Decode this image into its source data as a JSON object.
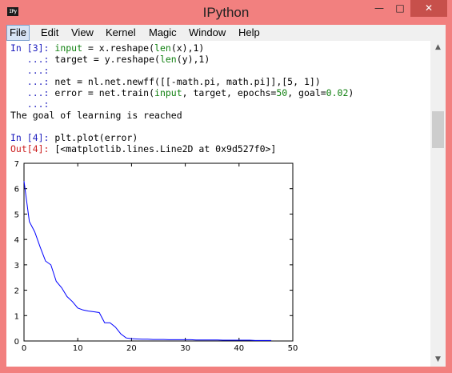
{
  "window": {
    "title": "IPython",
    "app_icon_text": "IPy",
    "controls": {
      "minimize": "—",
      "maximize": "□",
      "close": "✕"
    }
  },
  "menu": {
    "items": [
      "File",
      "Edit",
      "View",
      "Kernel",
      "Magic",
      "Window",
      "Help"
    ],
    "active": "File"
  },
  "console": {
    "cell3": {
      "in_prompt": "In [3]: ",
      "cont_prompt": "   ...: ",
      "l1_pre": "input",
      "l1_mid": " = x.reshape(",
      "l1_fn": "len",
      "l1_post": "(x),1)",
      "l2_pre": "target = y.reshape(",
      "l2_fn": "len",
      "l2_post": "(y),1)",
      "l4_pre": "net = nl.net.newff([[-math.pi, math.pi]],[5, 1])",
      "l5_pre": "error = net.train(",
      "l5_kw": "input",
      "l5_mid": ", target, epochs=",
      "l5_n1": "50",
      "l5_mid2": ", goal=",
      "l5_n2": "0.02",
      "l5_post": ")",
      "output": "The goal of learning is reached"
    },
    "cell4": {
      "in_prompt": "In [4]: ",
      "code": "plt.plot(error)",
      "out_prompt": "Out[4]: ",
      "output": "[<matplotlib.lines.Line2D at 0x9d527f0>]"
    }
  },
  "scrollbar": {
    "up": "▲",
    "down": "▼"
  },
  "chart_data": {
    "type": "line",
    "title": "",
    "xlabel": "",
    "ylabel": "",
    "xlim": [
      0,
      50
    ],
    "ylim": [
      0,
      7
    ],
    "xticks": [
      0,
      10,
      20,
      30,
      40,
      50
    ],
    "yticks": [
      0,
      1,
      2,
      3,
      4,
      5,
      6,
      7
    ],
    "grid": false,
    "line_color": "#0000ff",
    "series": [
      {
        "x": [
          0,
          1,
          2,
          3,
          4,
          5,
          6,
          7,
          8,
          9,
          10,
          11,
          12,
          13,
          14,
          15,
          16,
          17,
          18,
          19,
          20,
          21,
          22,
          23,
          24,
          25,
          26,
          27,
          28,
          29,
          30,
          31,
          32,
          33,
          34,
          35,
          36,
          37,
          38,
          39,
          40,
          41,
          42,
          43,
          44,
          45,
          46
        ],
        "y": [
          6.3,
          4.7,
          4.3,
          3.7,
          3.15,
          3.0,
          2.35,
          2.1,
          1.75,
          1.55,
          1.3,
          1.22,
          1.18,
          1.15,
          1.12,
          0.72,
          0.72,
          0.55,
          0.28,
          0.12,
          0.09,
          0.08,
          0.07,
          0.07,
          0.06,
          0.06,
          0.06,
          0.05,
          0.05,
          0.05,
          0.05,
          0.05,
          0.04,
          0.04,
          0.04,
          0.04,
          0.04,
          0.03,
          0.03,
          0.03,
          0.03,
          0.03,
          0.03,
          0.02,
          0.02,
          0.02,
          0.02
        ]
      }
    ]
  }
}
